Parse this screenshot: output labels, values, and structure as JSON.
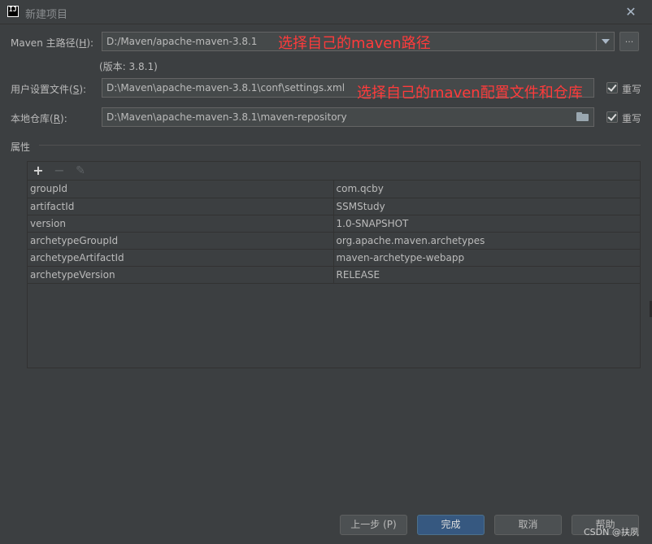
{
  "window": {
    "title": "新建项目",
    "close_glyph": "✕"
  },
  "maven_home": {
    "label_prefix": "Maven 主路径(",
    "label_mnemonic": "H",
    "label_suffix": "):",
    "value": "D:/Maven/apache-maven-3.8.1",
    "browse_label": "...",
    "version_text": "(版本: 3.8.1)"
  },
  "settings_file": {
    "label_prefix": "用户设置文件(",
    "label_mnemonic": "S",
    "label_suffix": "):",
    "value": "D:\\Maven\\apache-maven-3.8.1\\conf\\settings.xml",
    "override_label": "重写",
    "override_checked": true
  },
  "local_repo": {
    "label_prefix": "本地仓库(",
    "label_mnemonic": "R",
    "label_suffix": "):",
    "value": "D:\\Maven\\apache-maven-3.8.1\\maven-repository",
    "override_label": "重写",
    "override_checked": true
  },
  "annotations": {
    "maven_path": "选择自己的maven路径",
    "maven_config": "选择自己的maven配置文件和仓库"
  },
  "properties": {
    "section_label": "属性",
    "toolbar": {
      "add_glyph": "+",
      "remove_glyph": "−",
      "edit_glyph": "✎"
    },
    "rows": [
      {
        "key": "groupId",
        "value": "com.qcby"
      },
      {
        "key": "artifactId",
        "value": "SSMStudy"
      },
      {
        "key": "version",
        "value": "1.0-SNAPSHOT"
      },
      {
        "key": "archetypeGroupId",
        "value": "org.apache.maven.archetypes"
      },
      {
        "key": "archetypeArtifactId",
        "value": "maven-archetype-webapp"
      },
      {
        "key": "archetypeVersion",
        "value": "RELEASE"
      }
    ]
  },
  "footer": {
    "previous_label": "上一步 (P)",
    "finish_label": "完成",
    "cancel_label": "取消",
    "help_label": "帮助"
  },
  "watermark": "CSDN @扶夙",
  "colors": {
    "background": "#3c3f41",
    "field_bg": "#45494a",
    "primary_button": "#365880",
    "annotation": "#ff3b3b"
  }
}
